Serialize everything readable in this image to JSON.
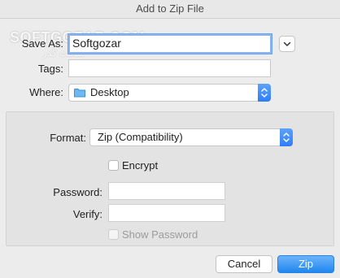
{
  "window": {
    "title": "Add to Zip File"
  },
  "watermark": {
    "line1": "SOFTGOZAR.COM",
    "line2": "سافت گذر"
  },
  "save_as": {
    "label": "Save As:",
    "value": "Softgozar"
  },
  "tags": {
    "label": "Tags:",
    "value": ""
  },
  "where": {
    "label": "Where:",
    "value": "Desktop",
    "icon": "folder-icon"
  },
  "options": {
    "format_label": "Format:",
    "format_value": "Zip (Compatibility)",
    "encrypt_label": "Encrypt",
    "encrypt_checked": false,
    "password_label": "Password:",
    "password_value": "",
    "verify_label": "Verify:",
    "verify_value": "",
    "show_password_label": "Show Password",
    "show_password_checked": false
  },
  "buttons": {
    "cancel": "Cancel",
    "zip": "Zip"
  },
  "colors": {
    "accent": "#2f7ef8",
    "focus_ring": "#8cb4f0"
  }
}
